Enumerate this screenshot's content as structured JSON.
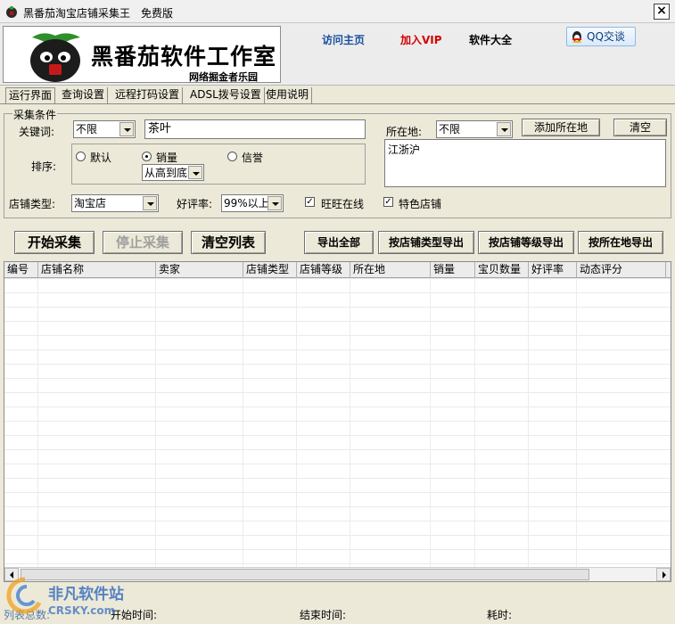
{
  "window": {
    "title": "黑番茄淘宝店铺采集王",
    "edition": "免费版",
    "close": "×"
  },
  "header": {
    "logo_main": "黑番茄软件工作室",
    "logo_sub": "网络掘金者乐园",
    "links": [
      {
        "label": "访问主页",
        "color": "#1a4fa0"
      },
      {
        "label": "加入VIP",
        "color": "#d40000"
      },
      {
        "label": "软件大全",
        "color": "#000000"
      }
    ],
    "qq_label": "QQ交谈"
  },
  "tabs": [
    "运行界面",
    "查询设置",
    "远程打码设置",
    "ADSL拨号设置",
    "使用说明"
  ],
  "criteria": {
    "legend": "采集条件",
    "keyword_label": "关键词:",
    "keyword_scope": "不限",
    "keyword_value": "茶叶",
    "location_label": "所在地:",
    "location_value": "不限",
    "add_location": "添加所在地",
    "clear": "清空",
    "location_list": "江浙沪",
    "sort_label": "排序:",
    "sort_options": [
      "默认",
      "销量",
      "信誉"
    ],
    "sort_order": "从高到底",
    "shop_type_label": "店铺类型:",
    "shop_type_value": "淘宝店",
    "rating_label": "好评率:",
    "rating_value": "99%以上",
    "wangwang_online": "旺旺在线",
    "special_shop": "特色店铺"
  },
  "actions": {
    "start": "开始采集",
    "stop": "停止采集",
    "clear_list": "清空列表",
    "export_all": "导出全部",
    "export_by_type": "按店铺类型导出",
    "export_by_level": "按店铺等级导出",
    "export_by_location": "按所在地导出"
  },
  "table": {
    "columns": [
      "编号",
      "店铺名称",
      "卖家",
      "店铺类型",
      "店铺等级",
      "所在地",
      "销量",
      "宝贝数量",
      "好评率",
      "动态评分"
    ]
  },
  "status": {
    "list_total": "列表总数:",
    "start_time": "开始时间:",
    "end_time": "结束时间:",
    "elapsed": "耗时:"
  },
  "watermark": {
    "name": "非凡软件站",
    "domain": "CRSKY.com"
  }
}
